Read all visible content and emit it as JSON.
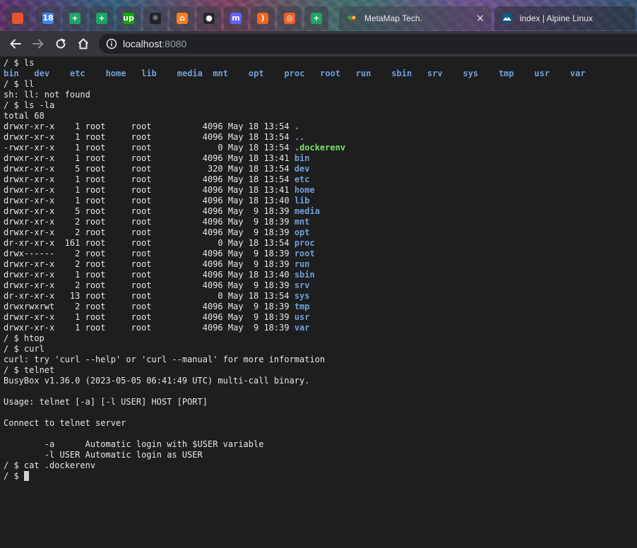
{
  "pinned_tabs": [
    {
      "icon": "firefox-icon",
      "label": "",
      "color": "#e8532f"
    },
    {
      "icon": "calendar-icon",
      "label": "18",
      "color": "#4285f4"
    },
    {
      "icon": "sheets-icon",
      "label": "+",
      "color": "#1fa463"
    },
    {
      "icon": "sheets-icon",
      "label": "+",
      "color": "#1fa463"
    },
    {
      "icon": "upwork-icon",
      "label": "up",
      "color": "#14a800"
    },
    {
      "icon": "react-icon",
      "label": "⚛",
      "color": "#20232a"
    },
    {
      "icon": "cloud-icon",
      "label": "⌂",
      "color": "#f38020"
    },
    {
      "icon": "github-icon",
      "label": "●",
      "color": "#24292e"
    },
    {
      "icon": "mastodon-icon",
      "label": "m",
      "color": "#6364ff"
    },
    {
      "icon": "rss-icon",
      "label": ")",
      "color": "#f26522"
    },
    {
      "icon": "record-icon",
      "label": "◎",
      "color": "#e8632a"
    },
    {
      "icon": "sheets-icon",
      "label": "+",
      "color": "#1fa463"
    }
  ],
  "tabs": [
    {
      "title": "MetaMap Tech.",
      "close": "×"
    },
    {
      "title": "index | Alpine Linux",
      "close": ""
    }
  ],
  "address": {
    "host": "localhost",
    "port": ":8080"
  },
  "terminal_lines": [
    {
      "segs": [
        {
          "t": "/ $ ls"
        }
      ]
    },
    {
      "segs": [
        {
          "t": "bin",
          "c": "dir"
        },
        {
          "t": "   "
        },
        {
          "t": "dev",
          "c": "dir"
        },
        {
          "t": "    "
        },
        {
          "t": "etc",
          "c": "dir"
        },
        {
          "t": "    "
        },
        {
          "t": "home",
          "c": "dir"
        },
        {
          "t": "   "
        },
        {
          "t": "lib",
          "c": "dir"
        },
        {
          "t": "    "
        },
        {
          "t": "media",
          "c": "dir"
        },
        {
          "t": "  "
        },
        {
          "t": "mnt",
          "c": "dir"
        },
        {
          "t": "    "
        },
        {
          "t": "opt",
          "c": "dir"
        },
        {
          "t": "    "
        },
        {
          "t": "proc",
          "c": "dir"
        },
        {
          "t": "   "
        },
        {
          "t": "root",
          "c": "dir"
        },
        {
          "t": "   "
        },
        {
          "t": "run",
          "c": "dir"
        },
        {
          "t": "    "
        },
        {
          "t": "sbin",
          "c": "dir"
        },
        {
          "t": "   "
        },
        {
          "t": "srv",
          "c": "dir"
        },
        {
          "t": "    "
        },
        {
          "t": "sys",
          "c": "dir"
        },
        {
          "t": "    "
        },
        {
          "t": "tmp",
          "c": "dir"
        },
        {
          "t": "    "
        },
        {
          "t": "usr",
          "c": "dir"
        },
        {
          "t": "    "
        },
        {
          "t": "var",
          "c": "dir"
        }
      ]
    },
    {
      "segs": [
        {
          "t": "/ $ ll"
        }
      ]
    },
    {
      "segs": [
        {
          "t": "sh: ll: not found"
        }
      ]
    },
    {
      "segs": [
        {
          "t": "/ $ ls -la"
        }
      ]
    },
    {
      "segs": [
        {
          "t": "total 68"
        }
      ]
    },
    {
      "segs": [
        {
          "t": "drwxr-xr-x    1 root     root          4096 May 18 13:54 "
        },
        {
          "t": ".",
          "c": "dir"
        }
      ]
    },
    {
      "segs": [
        {
          "t": "drwxr-xr-x    1 root     root          4096 May 18 13:54 "
        },
        {
          "t": "..",
          "c": "dir"
        }
      ]
    },
    {
      "segs": [
        {
          "t": "-rwxr-xr-x    1 root     root             0 May 18 13:54 "
        },
        {
          "t": ".dockerenv",
          "c": "exe"
        }
      ]
    },
    {
      "segs": [
        {
          "t": "drwxr-xr-x    1 root     root          4096 May 18 13:41 "
        },
        {
          "t": "bin",
          "c": "dir"
        }
      ]
    },
    {
      "segs": [
        {
          "t": "drwxr-xr-x    5 root     root           320 May 18 13:54 "
        },
        {
          "t": "dev",
          "c": "dir"
        }
      ]
    },
    {
      "segs": [
        {
          "t": "drwxr-xr-x    1 root     root          4096 May 18 13:54 "
        },
        {
          "t": "etc",
          "c": "dir"
        }
      ]
    },
    {
      "segs": [
        {
          "t": "drwxr-xr-x    1 root     root          4096 May 18 13:41 "
        },
        {
          "t": "home",
          "c": "dir"
        }
      ]
    },
    {
      "segs": [
        {
          "t": "drwxr-xr-x    1 root     root          4096 May 18 13:40 "
        },
        {
          "t": "lib",
          "c": "dir"
        }
      ]
    },
    {
      "segs": [
        {
          "t": "drwxr-xr-x    5 root     root          4096 May  9 18:39 "
        },
        {
          "t": "media",
          "c": "dir"
        }
      ]
    },
    {
      "segs": [
        {
          "t": "drwxr-xr-x    2 root     root          4096 May  9 18:39 "
        },
        {
          "t": "mnt",
          "c": "dir"
        }
      ]
    },
    {
      "segs": [
        {
          "t": "drwxr-xr-x    2 root     root          4096 May  9 18:39 "
        },
        {
          "t": "opt",
          "c": "dir"
        }
      ]
    },
    {
      "segs": [
        {
          "t": "dr-xr-xr-x  161 root     root             0 May 18 13:54 "
        },
        {
          "t": "proc",
          "c": "dir"
        }
      ]
    },
    {
      "segs": [
        {
          "t": "drwx------    2 root     root          4096 May  9 18:39 "
        },
        {
          "t": "root",
          "c": "dir"
        }
      ]
    },
    {
      "segs": [
        {
          "t": "drwxr-xr-x    2 root     root          4096 May  9 18:39 "
        },
        {
          "t": "run",
          "c": "dir"
        }
      ]
    },
    {
      "segs": [
        {
          "t": "drwxr-xr-x    1 root     root          4096 May 18 13:40 "
        },
        {
          "t": "sbin",
          "c": "dir"
        }
      ]
    },
    {
      "segs": [
        {
          "t": "drwxr-xr-x    2 root     root          4096 May  9 18:39 "
        },
        {
          "t": "srv",
          "c": "dir"
        }
      ]
    },
    {
      "segs": [
        {
          "t": "dr-xr-xr-x   13 root     root             0 May 18 13:54 "
        },
        {
          "t": "sys",
          "c": "dir"
        }
      ]
    },
    {
      "segs": [
        {
          "t": "drwxrwxrwt    2 root     root          4096 May  9 18:39 "
        },
        {
          "t": "tmp",
          "c": "dir"
        }
      ]
    },
    {
      "segs": [
        {
          "t": "drwxr-xr-x    1 root     root          4096 May  9 18:39 "
        },
        {
          "t": "usr",
          "c": "dir"
        }
      ]
    },
    {
      "segs": [
        {
          "t": "drwxr-xr-x    1 root     root          4096 May  9 18:39 "
        },
        {
          "t": "var",
          "c": "dir"
        }
      ]
    },
    {
      "segs": [
        {
          "t": "/ $ htop"
        }
      ]
    },
    {
      "segs": [
        {
          "t": "/ $ curl"
        }
      ]
    },
    {
      "segs": [
        {
          "t": "curl: try 'curl --help' or 'curl --manual' for more information"
        }
      ]
    },
    {
      "segs": [
        {
          "t": "/ $ telnet"
        }
      ]
    },
    {
      "segs": [
        {
          "t": "BusyBox v1.36.0 (2023-05-05 06:41:49 UTC) multi-call binary."
        }
      ]
    },
    {
      "segs": [
        {
          "t": ""
        }
      ]
    },
    {
      "segs": [
        {
          "t": "Usage: telnet [-a] [-l USER] HOST [PORT]"
        }
      ]
    },
    {
      "segs": [
        {
          "t": ""
        }
      ]
    },
    {
      "segs": [
        {
          "t": "Connect to telnet server"
        }
      ]
    },
    {
      "segs": [
        {
          "t": ""
        }
      ]
    },
    {
      "segs": [
        {
          "t": "        -a      Automatic login with $USER variable"
        }
      ]
    },
    {
      "segs": [
        {
          "t": "        -l USER Automatic login as USER"
        }
      ]
    },
    {
      "segs": [
        {
          "t": "/ $ cat .dockerenv"
        }
      ]
    }
  ],
  "prompt": "/ $ "
}
